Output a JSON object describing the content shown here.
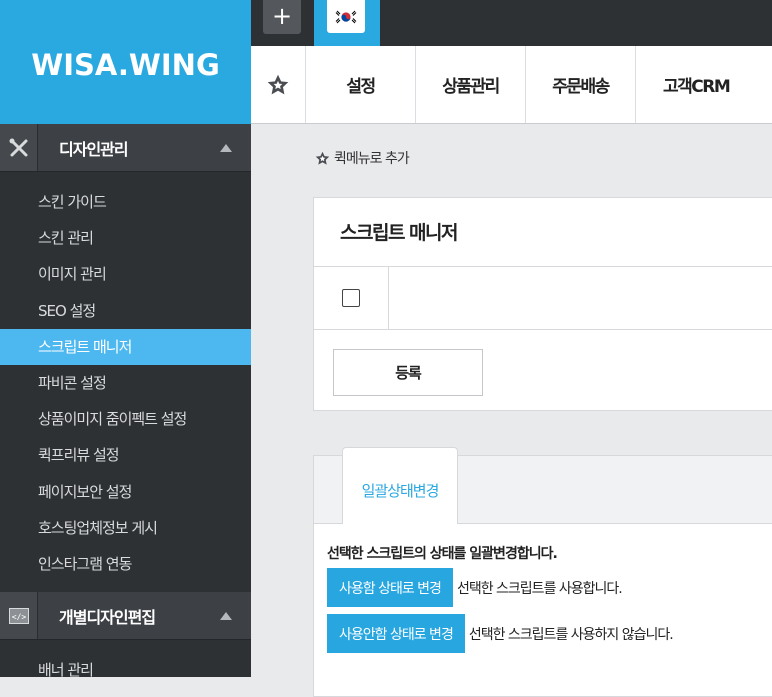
{
  "brand": {
    "logo": "WISA.WING"
  },
  "topbar": {
    "add_label": "+",
    "flag_icon": "korea-flag-icon"
  },
  "menubar": {
    "star_icon": "star-icon",
    "tabs": [
      {
        "label": "설정"
      },
      {
        "label": "상품관리"
      },
      {
        "label": "주문배송"
      },
      {
        "label": "고객CRM"
      }
    ]
  },
  "sidebar": {
    "sections": [
      {
        "title": "디자인관리",
        "icon": "tools-icon",
        "items": [
          {
            "label": "스킨 가이드"
          },
          {
            "label": "스킨 관리"
          },
          {
            "label": "이미지 관리"
          },
          {
            "label": "SEO 설정"
          },
          {
            "label": "스크립트 매니저"
          },
          {
            "label": "파비콘 설정"
          },
          {
            "label": "상품이미지 줌이펙트 설정"
          },
          {
            "label": "퀵프리뷰 설정"
          },
          {
            "label": "페이지보안 설정"
          },
          {
            "label": "호스팅업체정보 게시"
          },
          {
            "label": "인스타그램 연동"
          }
        ]
      },
      {
        "title": "개별디자인편집",
        "icon": "code-icon",
        "items": [
          {
            "label": "배너 관리"
          }
        ]
      }
    ]
  },
  "content": {
    "quick_menu": "퀵메뉴로 추가",
    "title": "스크립트 매니저",
    "register_label": "등록",
    "status_tab": "일괄상태변경",
    "status_desc": "선택한 스크립트의 상태를 일괄변경합니다.",
    "enable_btn": "사용함 상태로 변경",
    "enable_text": "선택한 스크립트를 사용합니다.",
    "disable_btn": "사용안함 상태로 변경",
    "disable_text": "선택한 스크립트를 사용하지 않습니다."
  },
  "colors": {
    "brand_blue": "#2aa8e0",
    "sidebar_active": "#4db8f0",
    "sidebar_bg": "#2e3134"
  }
}
